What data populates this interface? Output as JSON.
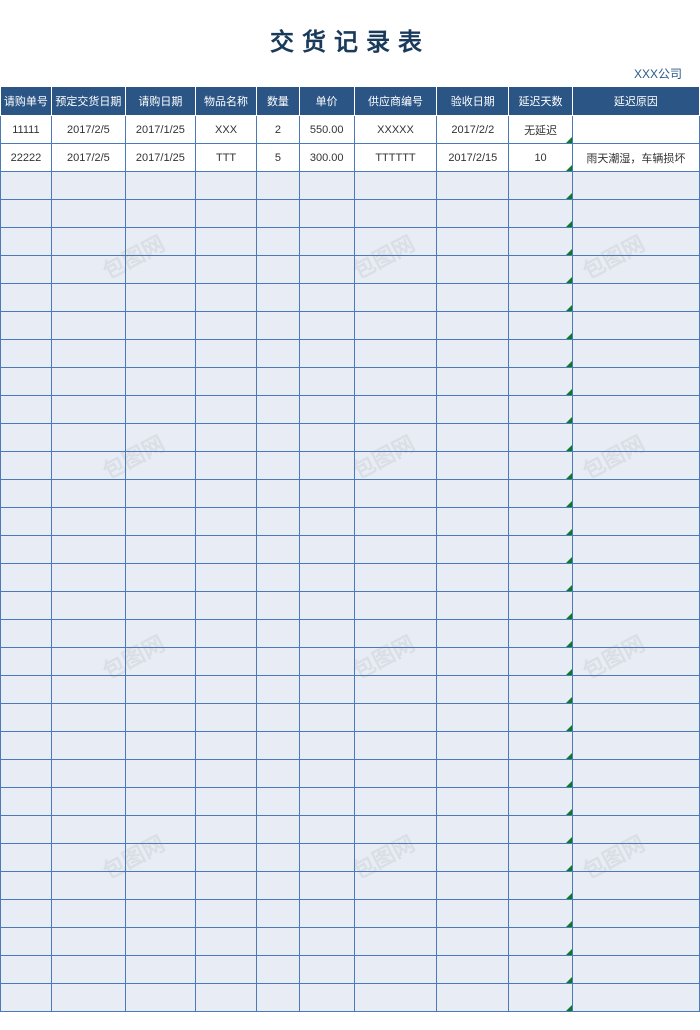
{
  "title": "交货记录表",
  "company": "XXX公司",
  "columns": [
    "请购单号",
    "预定交货日期",
    "请购日期",
    "物品名称",
    "数量",
    "单价",
    "供应商编号",
    "验收日期",
    "延迟天数",
    "延迟原因"
  ],
  "rows": [
    {
      "order_no": "11111",
      "scheduled_date": "2017/2/5",
      "request_date": "2017/1/25",
      "item_name": "XXX",
      "quantity": "2",
      "unit_price": "550.00",
      "supplier_no": "XXXXX",
      "accept_date": "2017/2/2",
      "delay_days": "无延迟",
      "delay_reason": ""
    },
    {
      "order_no": "22222",
      "scheduled_date": "2017/2/5",
      "request_date": "2017/1/25",
      "item_name": "TTT",
      "quantity": "5",
      "unit_price": "300.00",
      "supplier_no": "TTTTTT",
      "accept_date": "2017/2/15",
      "delay_days": "10",
      "delay_reason": "雨天潮湿，车辆损坏"
    }
  ],
  "empty_row_count": 30,
  "watermark_text": "包图网",
  "colors": {
    "header_bg": "#2a5585",
    "header_text": "#ffffff",
    "grid_border": "#4a7ab8",
    "empty_cell_bg": "#e8edf5",
    "data_cell_bg": "#ffffff",
    "title_color": "#1a3a5c",
    "corner_mark": "#0a7a2a"
  }
}
